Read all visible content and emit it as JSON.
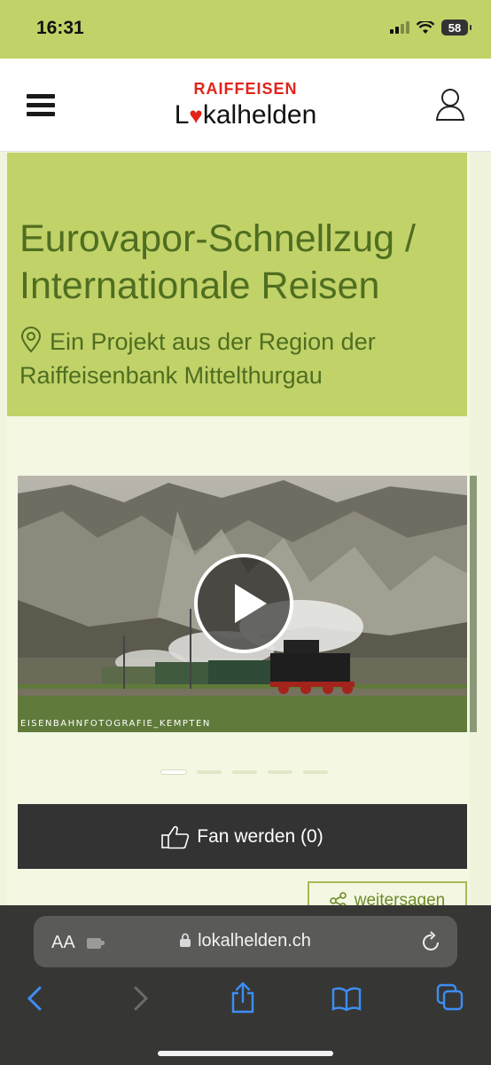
{
  "status_bar": {
    "time": "16:31",
    "battery": "58"
  },
  "header": {
    "brand_top": "RAIFFEISEN",
    "brand_l": "L",
    "brand_rest": "kalhelden"
  },
  "hero": {
    "title": "Eurovapor-Schnellzug / Internationale Reisen",
    "region": "Ein Projekt aus der Region der Raiffeisenbank Mittelthurgau"
  },
  "media": {
    "photo_credit": "EISENBAHNFOTOGRAFIE_KEMPTEN",
    "slide_count": 5,
    "active_slide": 1
  },
  "actions": {
    "fan_label": "Fan werden (0)",
    "share_label": "weitersagen"
  },
  "browser": {
    "aa_label": "AA",
    "url": "lokalhelden.ch"
  },
  "colors": {
    "accent_green": "#c1d268",
    "title_green": "#4f6e21",
    "brand_red": "#e2231a",
    "dark_button": "#333333"
  },
  "icons": [
    "menu-icon",
    "heart-icon",
    "user-icon",
    "map-pin-icon",
    "play-icon",
    "thumbs-up-icon",
    "share-icon",
    "lock-icon",
    "reload-icon",
    "back-icon",
    "forward-icon",
    "share-sheet-icon",
    "bookmarks-icon",
    "tabs-icon"
  ]
}
